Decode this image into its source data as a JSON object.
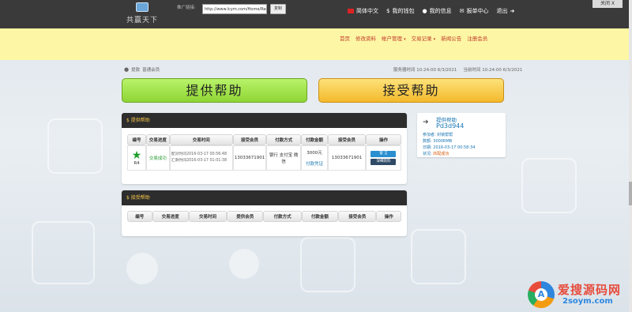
{
  "topbar": {
    "logo_text": "共赢天下",
    "promo_label": "推广链接:",
    "promo_url": "http://www.lcym.com/Home/Regist",
    "copy_label": "复制",
    "links": [
      {
        "icon": "flag-icon",
        "label": "简体中文"
      },
      {
        "icon": "dollar-icon",
        "label": "我的钱包"
      },
      {
        "icon": "user-icon",
        "label": "我的信息"
      },
      {
        "icon": "envelope-icon",
        "label": "报单中心"
      },
      {
        "icon": "logout-icon",
        "label": "退出"
      }
    ],
    "close_label": "关闭 X"
  },
  "nav": {
    "items": [
      "首页",
      "修改资料",
      "帐户管理",
      "交易记录",
      "新闻公告",
      "注册会员"
    ]
  },
  "breadcrumb": {
    "icon": "user-icon",
    "name": "提款",
    "level": "普通会员"
  },
  "times": {
    "server_label": "服务器时间",
    "server_time": "10:24:00 6/3/2021",
    "local_label": "当前时间",
    "local_time": "10:24:00 6/3/2021"
  },
  "big_buttons": {
    "provide": "提供帮助",
    "receive": "接受帮助"
  },
  "panel_provide": {
    "title": "提供帮助",
    "headers": [
      "编号",
      "交易进度",
      "交易时间",
      "接受会员",
      "付款方式",
      "付款金额",
      "接受会员",
      "操作"
    ],
    "rows": [
      {
        "id": "R4",
        "status": "交易成功",
        "time1": "配对时间2016-03-17 00:56:48",
        "time2": "汇款时间2016-03-17 01:01:38",
        "receiver": "13033671901",
        "payment": "银行 支付宝 微信",
        "amount": "3000元",
        "proof": "付款凭证",
        "member": "13033671901",
        "btn1": "留 言",
        "btn2": "详细资料"
      }
    ]
  },
  "panel_receive": {
    "title": "接受帮助",
    "headers": [
      "编号",
      "交易进度",
      "交易时间",
      "提供会员",
      "付款方式",
      "付款金额",
      "接受会员",
      "操作"
    ]
  },
  "side_card": {
    "title": "提供帮助",
    "code": "Pd3d944",
    "lines": [
      "参加者: 封锁帮帮",
      "数额: 3000RMB",
      "日期: 2016-03-17 00:58:34"
    ],
    "status_label": "状况:",
    "status_value": "匹配成功"
  },
  "watermark": {
    "title": "爱搜源码网",
    "sub": "2soym.com",
    "letter": "A"
  }
}
